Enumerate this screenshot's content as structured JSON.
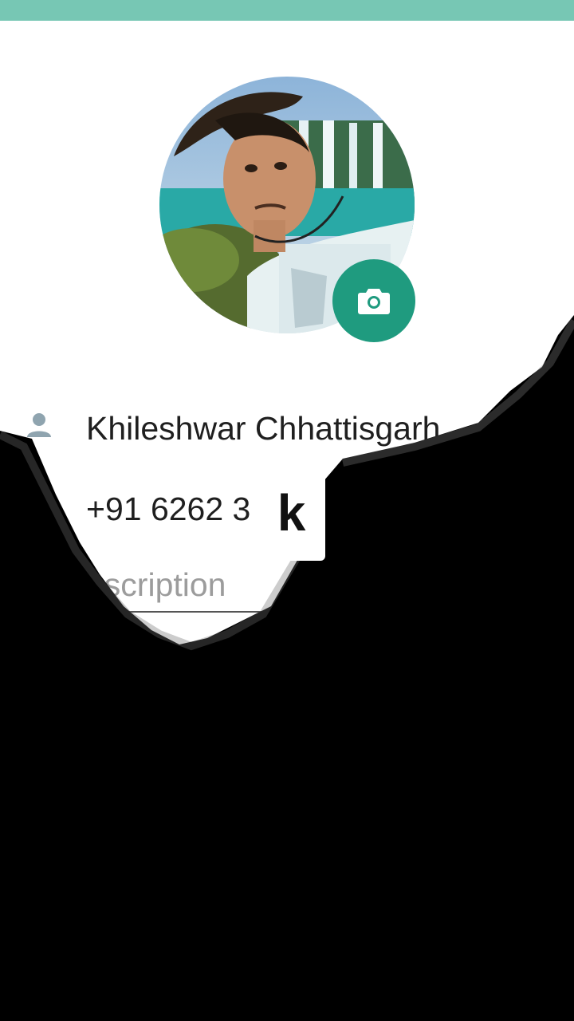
{
  "profile": {
    "name": "Khileshwar Chhattisgarh..",
    "phone": "+91 6262 3",
    "description_placeholder": "escription",
    "avatar_icon": "user-photo",
    "camera_icon": "camera-icon",
    "person_icon": "person-icon"
  },
  "overlay": {
    "badge_text": "k"
  },
  "colors": {
    "status_bar": "#77c7b4",
    "accent": "#1f9b7f",
    "overlay": "#000000"
  }
}
